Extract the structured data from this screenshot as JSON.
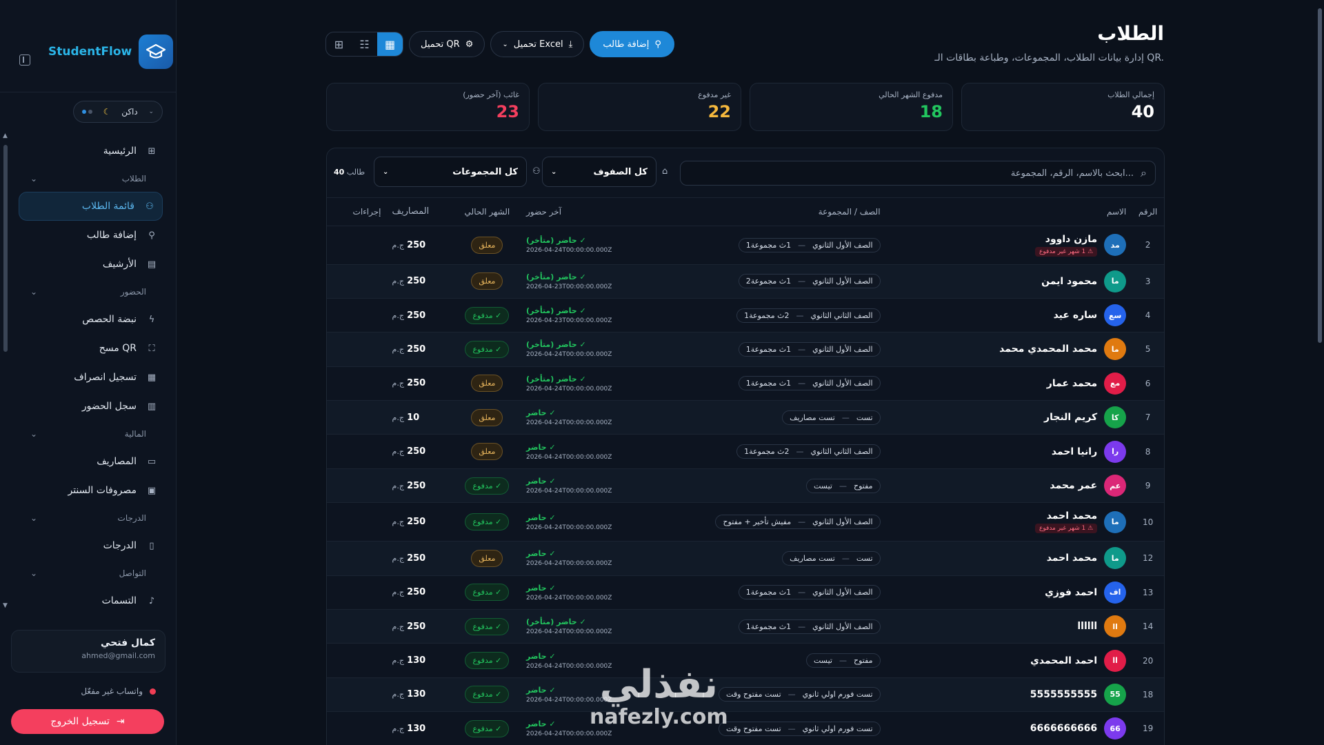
{
  "brand": {
    "name": "StudentFlow"
  },
  "theme": {
    "label": "داكن"
  },
  "nav": {
    "home": "الرئيسية",
    "group_students": "الطلاب",
    "student_list": "قائمة الطلاب",
    "add_student": "إضافة طالب",
    "archive": "الأرشيف",
    "group_attendance": "الحضور",
    "pulse": "نبضة الحصص",
    "scan_qr": "مسح QR",
    "checkout": "تسجيل انصراف",
    "attendance_log": "سجل الحضور",
    "group_finance": "المالية",
    "expenses": "المصاريف",
    "center_expenses": "مصروفات السنتر",
    "group_grades": "الدرجات",
    "grades": "الدرجات",
    "group_comm": "التواصل",
    "alerts": "التسمات"
  },
  "user": {
    "name": "كمال فتحي",
    "email": "ahmed@gmail.com"
  },
  "whatsapp": {
    "status": "واتساب غير مفعّل"
  },
  "logout": "تسجيل الخروج",
  "page": {
    "title": "الطلاب",
    "subtitle": "إدارة بيانات الطلاب، المجموعات، وطباعة بطاقات الـ QR."
  },
  "toolbar": {
    "add": "إضافة طالب",
    "excel": "تحميل Excel",
    "qr": "تحميل QR"
  },
  "stats": [
    {
      "label": "إجمالي الطلاب",
      "value": "40",
      "color": "#ffffff"
    },
    {
      "label": "مدفوع الشهر الحالي",
      "value": "18",
      "color": "#22c55e"
    },
    {
      "label": "غير مدفوع",
      "value": "22",
      "color": "#f5b83d"
    },
    {
      "label": "غائب (آخر حضور)",
      "value": "23",
      "color": "#f43f5e"
    }
  ],
  "filters": {
    "search_placeholder": "ابحث بالاسم، الرقم، المجموعة...",
    "grade_select": "كل الصفوف",
    "group_select": "كل المجموعات",
    "count_num": "40",
    "count_label": "طالب"
  },
  "table": {
    "headers": [
      "الرقم",
      "الاسم",
      "الصف / المجموعة",
      "آخر حضور",
      "الشهر الحالي",
      "المصاريف",
      "إجراءات"
    ],
    "currency": "ج.م",
    "unpaid_tag": "⚠ 1 شهر غير مدفوع",
    "paid_label": "✓ مدفوع",
    "pending_label": "معلق",
    "rows": [
      {
        "num": "2",
        "initials": "مد",
        "avatar_color": "#1e6fb8",
        "name": "مازن داوود",
        "grade": "الصف الأول الثانوي",
        "group": "1ث مجموعة1",
        "status": "✓ حاضر (متأخر)",
        "date": "2026-04-24T00:00:00.000Z",
        "paid": false,
        "fee": "250",
        "unpaid": true
      },
      {
        "num": "3",
        "initials": "ما",
        "avatar_color": "#0f9a8a",
        "name": "محمود ايمن",
        "grade": "الصف الأول الثانوي",
        "group": "1ث مجموعة2",
        "status": "✓ حاضر (متأخر)",
        "date": "2026-04-23T00:00:00.000Z",
        "paid": false,
        "fee": "250",
        "unpaid": false
      },
      {
        "num": "4",
        "initials": "سع",
        "avatar_color": "#2563eb",
        "name": "ساره عيد",
        "grade": "الصف الثاني الثانوي",
        "group": "2ث مجموعة1",
        "status": "✓ حاضر (متأخر)",
        "date": "2026-04-23T00:00:00.000Z",
        "paid": true,
        "fee": "250",
        "unpaid": false
      },
      {
        "num": "5",
        "initials": "ما",
        "avatar_color": "#e07a10",
        "name": "محمد المحمدي محمد",
        "grade": "الصف الأول الثانوي",
        "group": "1ث مجموعة1",
        "status": "✓ حاضر (متأخر)",
        "date": "2026-04-24T00:00:00.000Z",
        "paid": true,
        "fee": "250",
        "unpaid": false
      },
      {
        "num": "6",
        "initials": "مع",
        "avatar_color": "#e11d48",
        "name": "محمد عمار",
        "grade": "الصف الأول الثانوي",
        "group": "1ث مجموعة1",
        "status": "✓ حاضر (متأخر)",
        "date": "2026-04-24T00:00:00.000Z",
        "paid": false,
        "fee": "250",
        "unpaid": false
      },
      {
        "num": "7",
        "initials": "كا",
        "avatar_color": "#16a34a",
        "name": "كريم النجار",
        "grade": "تست",
        "group": "تست مصاريف",
        "status": "✓ حاضر",
        "date": "2026-04-24T00:00:00.000Z",
        "paid": false,
        "fee": "10",
        "unpaid": false
      },
      {
        "num": "8",
        "initials": "را",
        "avatar_color": "#7c3aed",
        "name": "رانيا احمد",
        "grade": "الصف الثاني الثانوي",
        "group": "2ث مجموعة1",
        "status": "✓ حاضر",
        "date": "2026-04-24T00:00:00.000Z",
        "paid": false,
        "fee": "250",
        "unpaid": false
      },
      {
        "num": "9",
        "initials": "عم",
        "avatar_color": "#db2777",
        "name": "عمر محمد",
        "grade": "مفتوح",
        "group": "تيست",
        "status": "✓ حاضر",
        "date": "2026-04-24T00:00:00.000Z",
        "paid": true,
        "fee": "250",
        "unpaid": false
      },
      {
        "num": "10",
        "initials": "ما",
        "avatar_color": "#1e6fb8",
        "name": "محمد احمد",
        "grade": "الصف الأول الثانوي",
        "group": "مفيش تأخير + مفتوح",
        "status": "✓ حاضر",
        "date": "2026-04-24T00:00:00.000Z",
        "paid": true,
        "fee": "250",
        "unpaid": true
      },
      {
        "num": "12",
        "initials": "ما",
        "avatar_color": "#0f9a8a",
        "name": "محمد احمد",
        "grade": "تست",
        "group": "تست مصاريف",
        "status": "✓ حاضر",
        "date": "2026-04-24T00:00:00.000Z",
        "paid": false,
        "fee": "250",
        "unpaid": false
      },
      {
        "num": "13",
        "initials": "اف",
        "avatar_color": "#2563eb",
        "name": "احمد فوزي",
        "grade": "الصف الأول الثانوي",
        "group": "1ث مجموعة1",
        "status": "✓ حاضر",
        "date": "2026-04-24T00:00:00.000Z",
        "paid": true,
        "fee": "250",
        "unpaid": false
      },
      {
        "num": "14",
        "initials": "ll",
        "avatar_color": "#e07a10",
        "name": "llllll",
        "grade": "الصف الأول الثانوي",
        "group": "1ث مجموعة1",
        "status": "✓ حاضر (متأخر)",
        "date": "2026-04-24T00:00:00.000Z",
        "paid": true,
        "fee": "250",
        "unpaid": false
      },
      {
        "num": "20",
        "initials": "اا",
        "avatar_color": "#e11d48",
        "name": "احمد المحمدي",
        "grade": "مفتوح",
        "group": "تيست",
        "status": "✓ حاضر",
        "date": "2026-04-24T00:00:00.000Z",
        "paid": true,
        "fee": "130",
        "unpaid": false
      },
      {
        "num": "18",
        "initials": "55",
        "avatar_color": "#16a34a",
        "name": "5555555555",
        "grade": "تست فورم اولي ثانوي",
        "group": "تست مفتوح وقت",
        "status": "✓ حاضر",
        "date": "2026-04-24T00:00:00.000Z",
        "paid": true,
        "fee": "130",
        "unpaid": false
      },
      {
        "num": "19",
        "initials": "66",
        "avatar_color": "#7c3aed",
        "name": "6666666666",
        "grade": "تست فورم اولي ثانوي",
        "group": "تست مفتوح وقت",
        "status": "✓ حاضر",
        "date": "2026-04-24T00:00:00.000Z",
        "paid": true,
        "fee": "130",
        "unpaid": false
      }
    ]
  },
  "watermark": {
    "arabic": "نفذلي",
    "latin": "nafezly.com"
  }
}
